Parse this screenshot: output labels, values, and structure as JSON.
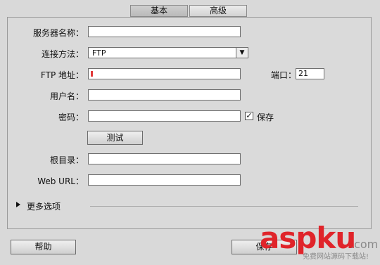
{
  "tabs": [
    {
      "label": "基本",
      "active": true
    },
    {
      "label": "高级",
      "active": false
    }
  ],
  "fields": {
    "server_name": {
      "label": "服务器名称：",
      "value": ""
    },
    "connect_method": {
      "label": "连接方法：",
      "value": "FTP"
    },
    "ftp_address": {
      "label": "FTP 地址：",
      "value": ""
    },
    "port": {
      "label": "端口：",
      "value": "21"
    },
    "username": {
      "label": "用户名：",
      "value": ""
    },
    "password": {
      "label": "密码：",
      "value": ""
    },
    "save_password": {
      "label": "保存",
      "checked": true
    },
    "test_button": "测试",
    "root_dir": {
      "label": "根目录：",
      "value": ""
    },
    "web_url": {
      "label": "Web URL：",
      "value": ""
    }
  },
  "more_options": "更多选项",
  "footer": {
    "help": "帮助",
    "save": "保存"
  },
  "watermark": {
    "brand": "aspku",
    "suffix": ".com",
    "tagline": "免费网站源码下载站!"
  },
  "icons": {
    "dropdown": "triangle-down-icon",
    "expand": "triangle-right-icon",
    "checkbox": "checkmark-icon"
  },
  "colors": {
    "watermark_red": "#e0242a",
    "watermark_gray": "#8a8a8a"
  }
}
